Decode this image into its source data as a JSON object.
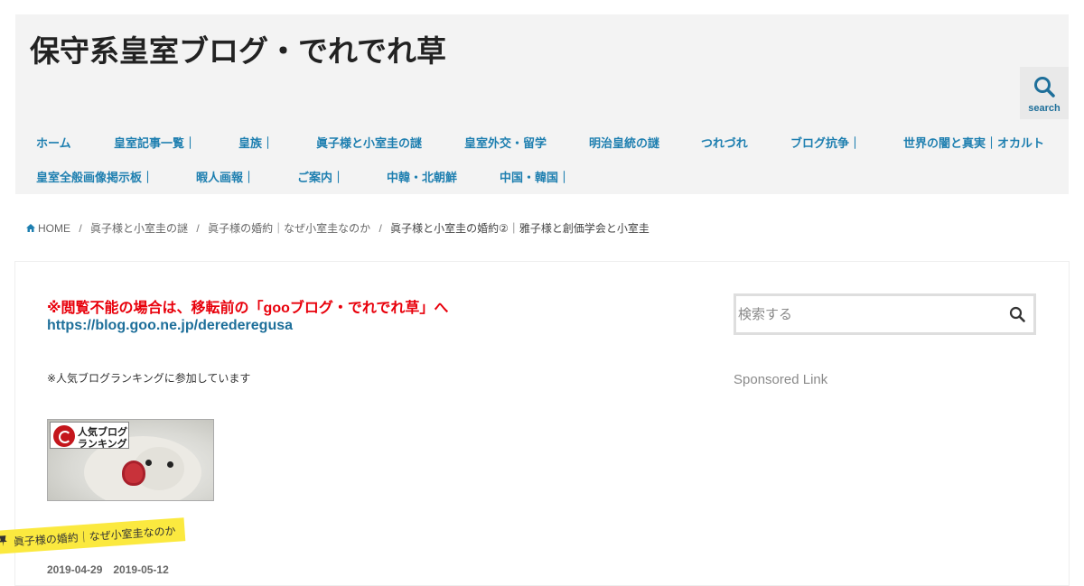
{
  "header": {
    "site_title": "保守系皇室ブログ・でれでれ草",
    "search_label": "search"
  },
  "nav": {
    "row1": [
      "ホーム",
      "皇室記事一覧｜",
      "皇族｜",
      "眞子様と小室圭の謎",
      "皇室外交・留学",
      "明治皇統の謎",
      "つれづれ",
      "ブログ抗争｜",
      "世界の闇と真実｜オカルト"
    ],
    "row2": [
      "皇室全般画像掲示板｜",
      "暇人画報｜",
      "ご案内｜",
      "中韓・北朝鮮",
      "中国・韓国｜"
    ]
  },
  "breadcrumb": {
    "home": "HOME",
    "items": [
      "眞子様と小室圭の謎",
      "眞子様の婚約｜なぜ小室圭なのか"
    ],
    "current": "眞子様と小室圭の婚約②｜雅子様と創価学会と小室圭",
    "separator": "/"
  },
  "article": {
    "notice": "※閲覧不能の場合は、移転前の「gooブログ・でれでれ草」へ",
    "notice_url": "https://blog.goo.ne.jp/derederegusa",
    "ranking_text": "※人気ブログランキングに参加しています",
    "banner_line1": "人気ブログ",
    "banner_line2": "ランキング",
    "category_ribbon": "眞子様の婚約｜なぜ小室圭なのか",
    "dates": "2019-04-29　2019-05-12"
  },
  "sidebar": {
    "search_placeholder": "検索する",
    "sponsored": "Sponsored Link"
  },
  "colors": {
    "header_bg": "#f3f3f3",
    "nav_link": "#1e7fb0",
    "notice_red": "#e8000b",
    "url_blue": "#1e6f9a",
    "ribbon_yellow": "#fbe93f"
  }
}
